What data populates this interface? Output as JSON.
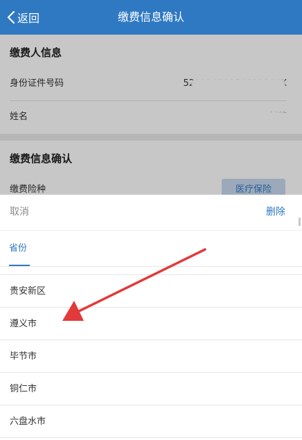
{
  "header": {
    "back_label": "返回",
    "title": "缴费信息确认"
  },
  "payer_section": {
    "title": "缴费人信息",
    "id_label": "身份证件号码",
    "id_value": "52212419950623204X",
    "name_label": "姓名",
    "name_value": "刘英"
  },
  "payment_section": {
    "title": "缴费信息确认",
    "insurance_label": "缴费险种",
    "insurance_value": "医疗保险"
  },
  "sheet": {
    "cancel_label": "取消",
    "delete_label": "删除",
    "tab_label": "省份",
    "items": [
      "贵安新区",
      "遵义市",
      "毕节市",
      "铜仁市",
      "六盘水市"
    ]
  },
  "colors": {
    "primary": "#2f79c3",
    "annotation_arrow": "#e23a3a"
  },
  "icons": {
    "back": "chevron-left-icon",
    "annotation": "red-arrow-annotation"
  }
}
